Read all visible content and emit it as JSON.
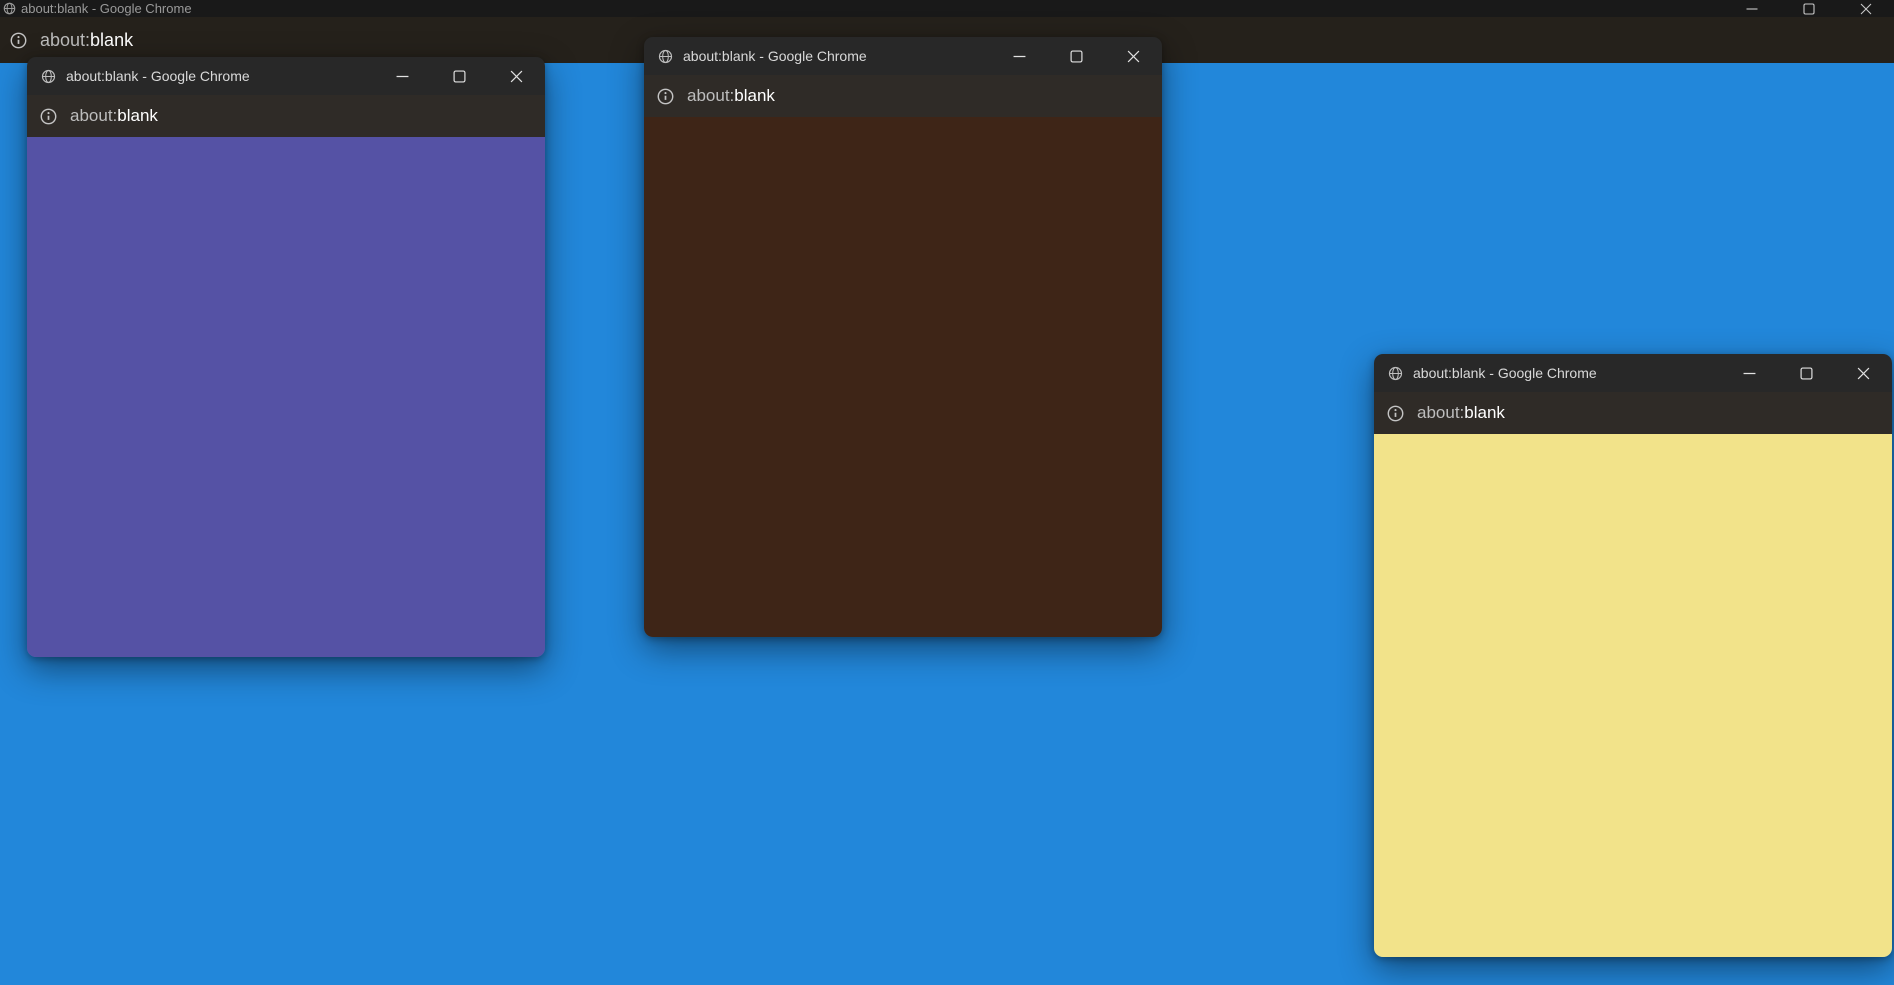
{
  "colors": {
    "desktop": "#2287da",
    "bg_window_titlebar": "#191919",
    "bg_window_addressbar": "#25211b",
    "float_titlebar": "#282828",
    "float_addressbar": "#2f2b27"
  },
  "background_window": {
    "title": "about:blank - Google Chrome",
    "url_prefix": "about:",
    "url_body": "blank"
  },
  "windows": [
    {
      "title": "about:blank - Google Chrome",
      "url_prefix": "about:",
      "url_body": "blank",
      "content_color": "#5552a5"
    },
    {
      "title": "about:blank - Google Chrome",
      "url_prefix": "about:",
      "url_body": "blank",
      "content_color": "#3e2517"
    },
    {
      "title": "about:blank - Google Chrome",
      "url_prefix": "about:",
      "url_body": "blank",
      "content_color": "#f2e38a"
    }
  ],
  "icons": {
    "globe": "🌐",
    "info": "ⓘ",
    "minimize": "–",
    "maximize": "▢",
    "close": "✕"
  }
}
